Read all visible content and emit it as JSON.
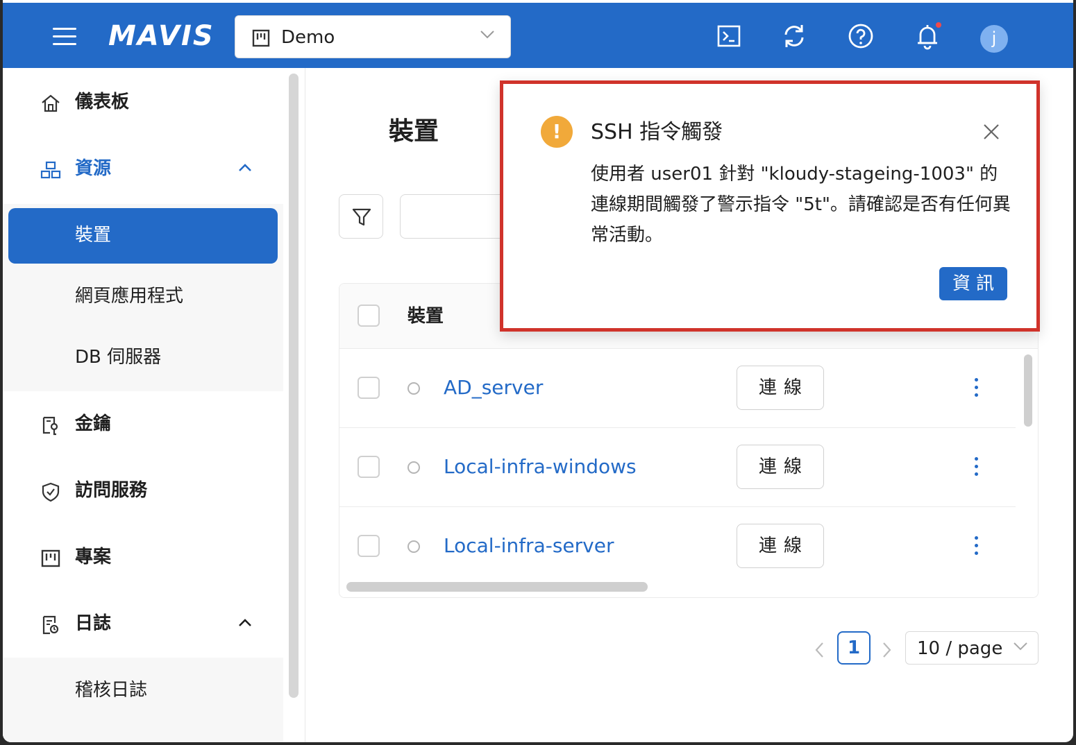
{
  "header": {
    "logo_text": "MAVIS",
    "project": "Demo",
    "avatar_initial": "j"
  },
  "sidebar": {
    "items": [
      {
        "label": "儀表板",
        "icon": "home-icon"
      },
      {
        "label": "資源",
        "icon": "resource-icon"
      },
      {
        "label": "金鑰",
        "icon": "key-icon"
      },
      {
        "label": "訪問服務",
        "icon": "shield-icon"
      },
      {
        "label": "專案",
        "icon": "project-icon"
      },
      {
        "label": "日誌",
        "icon": "log-icon"
      }
    ],
    "resource_sub": [
      "裝置",
      "網頁應用程式",
      "DB 伺服器"
    ],
    "log_sub": [
      "稽核日誌"
    ]
  },
  "main": {
    "title": "裝置",
    "search_value": "",
    "table": {
      "header": "裝置",
      "rows": [
        {
          "name": "AD_server",
          "action": "連線"
        },
        {
          "name": "Local-infra-windows",
          "action": "連線"
        },
        {
          "name": "Local-infra-server",
          "action": "連線"
        }
      ]
    },
    "pagination": {
      "current_page": "1",
      "page_size": "10 / page"
    }
  },
  "notification": {
    "title": "SSH 指令觸發",
    "body": "使用者 user01 針對 \"kloudy-stageing-1003\" 的連線期間觸發了警示指令 \"5t\"。請確認是否有任何異常活動。",
    "button": "資訊",
    "warning_symbol": "!"
  },
  "colors": {
    "primary": "#236ac7",
    "warning": "#f1a93a",
    "highlight_border": "#d0332b"
  }
}
